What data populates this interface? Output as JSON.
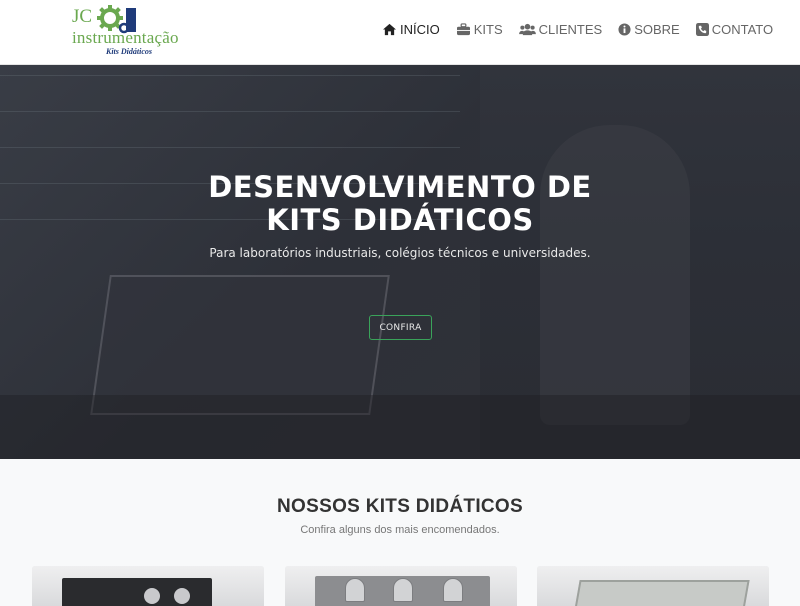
{
  "brand": {
    "logo_main": "JC",
    "logo_name": "instrumentação",
    "logo_tagline": "Kits Didáticos"
  },
  "nav": {
    "items": [
      {
        "label": "INÍCIO",
        "icon": "home-icon",
        "active": true
      },
      {
        "label": "KITS",
        "icon": "briefcase-icon",
        "active": false
      },
      {
        "label": "CLIENTES",
        "icon": "users-icon",
        "active": false
      },
      {
        "label": "SOBRE",
        "icon": "info-circle-icon",
        "active": false
      },
      {
        "label": "CONTATO",
        "icon": "phone-square-icon",
        "active": false
      }
    ]
  },
  "hero": {
    "title_line1": "DESENVOLVIMENTO DE",
    "title_line2": "KITS DIDÁTICOS",
    "subtitle": "Para laboratórios industriais, colégios técnicos e universidades.",
    "button_label": "CONFIRA"
  },
  "kits_section": {
    "title": "NOSSOS KITS DIDÁTICOS",
    "subtitle": "Confira alguns dos mais encomendados."
  },
  "colors": {
    "accent_green": "#3aa35a",
    "logo_green": "#6aa84f",
    "logo_blue": "#1f3b7a",
    "hero_overlay": "#2c2f37"
  }
}
